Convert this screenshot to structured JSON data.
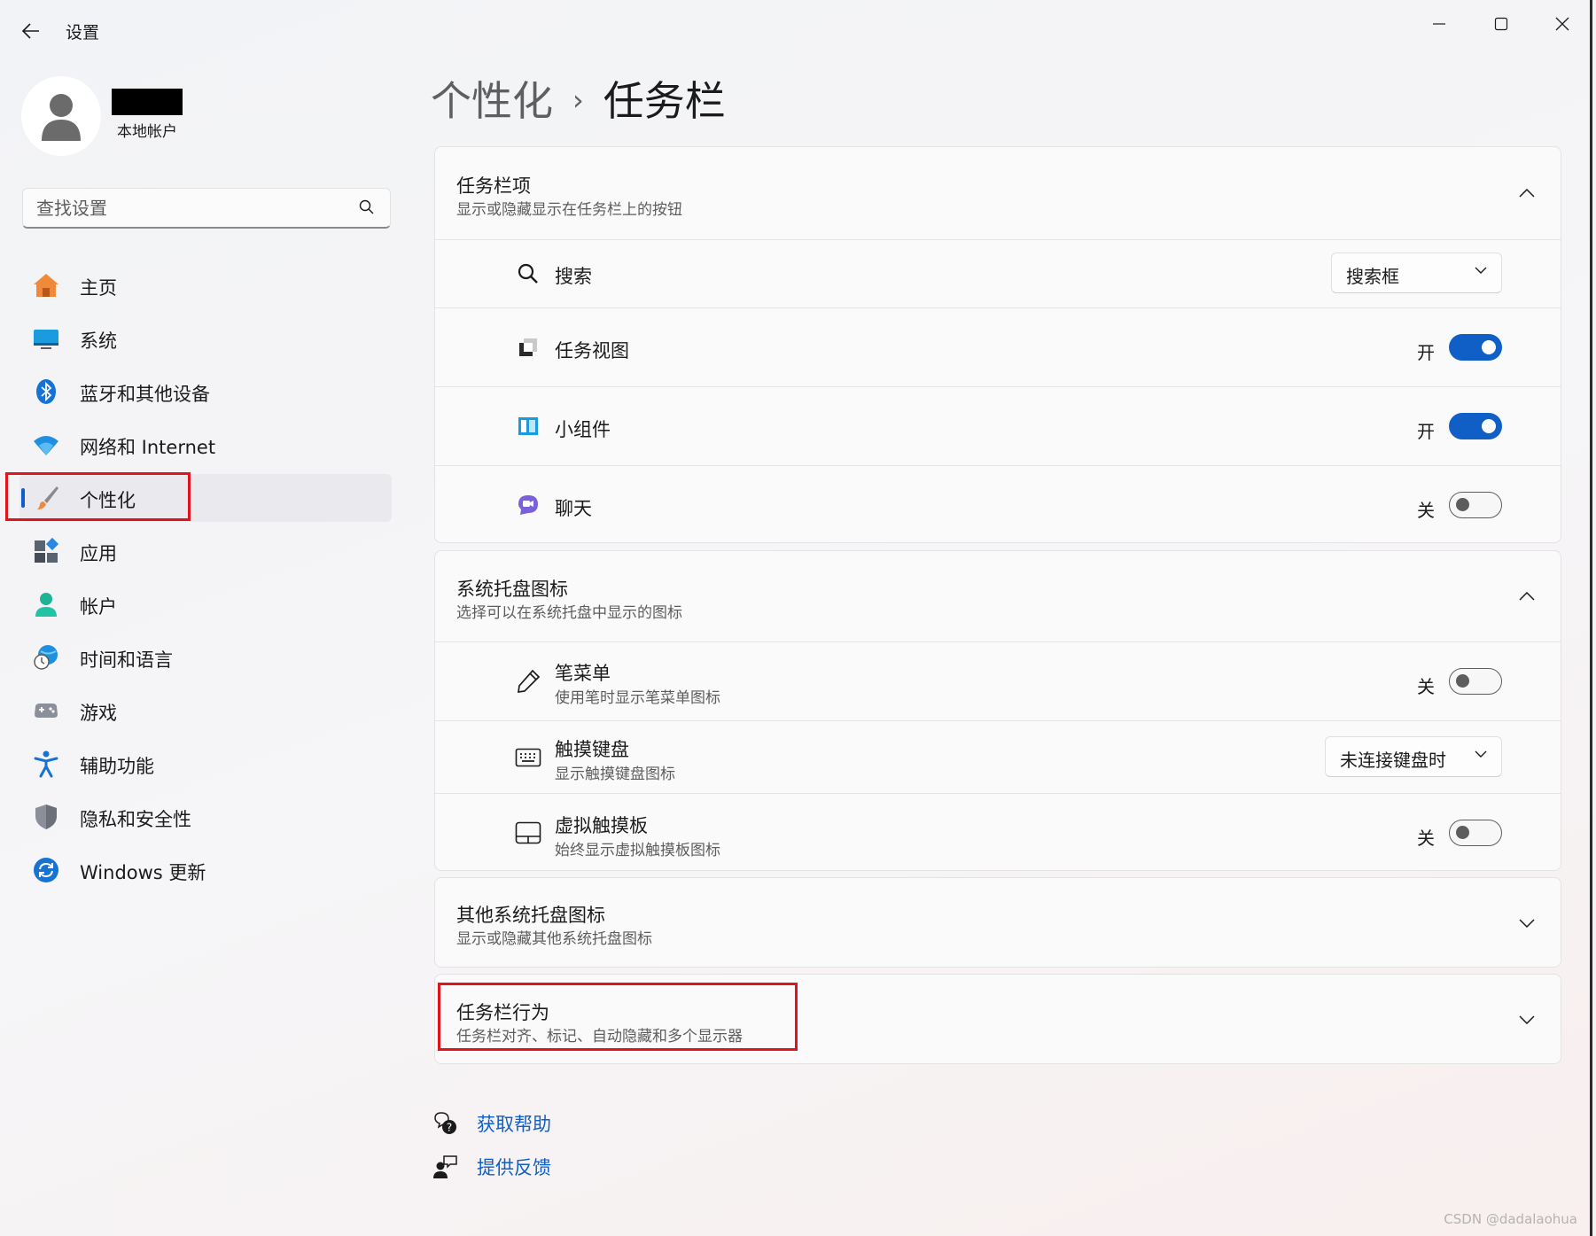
{
  "app": {
    "title": "设置"
  },
  "window_controls": [
    "minimize",
    "maximize",
    "close"
  ],
  "profile": {
    "account_type": "本地帐户"
  },
  "search": {
    "placeholder": "查找设置"
  },
  "nav": {
    "items": [
      {
        "label": "主页",
        "icon": "home-icon"
      },
      {
        "label": "系统",
        "icon": "monitor-icon"
      },
      {
        "label": "蓝牙和其他设备",
        "icon": "bluetooth-icon"
      },
      {
        "label": "网络和 Internet",
        "icon": "wifi-icon"
      },
      {
        "label": "个性化",
        "icon": "paintbrush-icon",
        "selected": true
      },
      {
        "label": "应用",
        "icon": "apps-icon"
      },
      {
        "label": "帐户",
        "icon": "person-icon"
      },
      {
        "label": "时间和语言",
        "icon": "globe-clock-icon"
      },
      {
        "label": "游戏",
        "icon": "gamepad-icon"
      },
      {
        "label": "辅助功能",
        "icon": "accessibility-icon"
      },
      {
        "label": "隐私和安全性",
        "icon": "shield-icon"
      },
      {
        "label": "Windows 更新",
        "icon": "sync-icon"
      }
    ]
  },
  "breadcrumb": {
    "parent": "个性化",
    "separator": "›",
    "current": "任务栏"
  },
  "sections": {
    "taskbar_items": {
      "title": "任务栏项",
      "subtitle": "显示或隐藏显示在任务栏上的按钮",
      "expanded": true,
      "rows": {
        "search": {
          "label": "搜索",
          "value": "搜索框"
        },
        "task_view": {
          "label": "任务视图",
          "state": "开",
          "on": true
        },
        "widgets": {
          "label": "小组件",
          "state": "开",
          "on": true
        },
        "chat": {
          "label": "聊天",
          "state": "关",
          "on": false
        }
      }
    },
    "system_tray": {
      "title": "系统托盘图标",
      "subtitle": "选择可以在系统托盘中显示的图标",
      "expanded": true,
      "rows": {
        "pen_menu": {
          "label": "笔菜单",
          "sub": "使用笔时显示笔菜单图标",
          "state": "关",
          "on": false
        },
        "touch_keyboard": {
          "label": "触摸键盘",
          "sub": "显示触摸键盘图标",
          "value": "未连接键盘时"
        },
        "virtual_touchpad": {
          "label": "虚拟触摸板",
          "sub": "始终显示虚拟触摸板图标",
          "state": "关",
          "on": false
        }
      }
    },
    "other_tray": {
      "title": "其他系统托盘图标",
      "subtitle": "显示或隐藏其他系统托盘图标",
      "expanded": false
    },
    "behaviors": {
      "title": "任务栏行为",
      "subtitle": "任务栏对齐、标记、自动隐藏和多个显示器",
      "expanded": false
    }
  },
  "help": {
    "get_help": "获取帮助",
    "feedback": "提供反馈"
  },
  "watermark": "CSDN @dadalaohua",
  "colors": {
    "accent": "#0f5fc7",
    "highlight_box": "#e1141d"
  }
}
